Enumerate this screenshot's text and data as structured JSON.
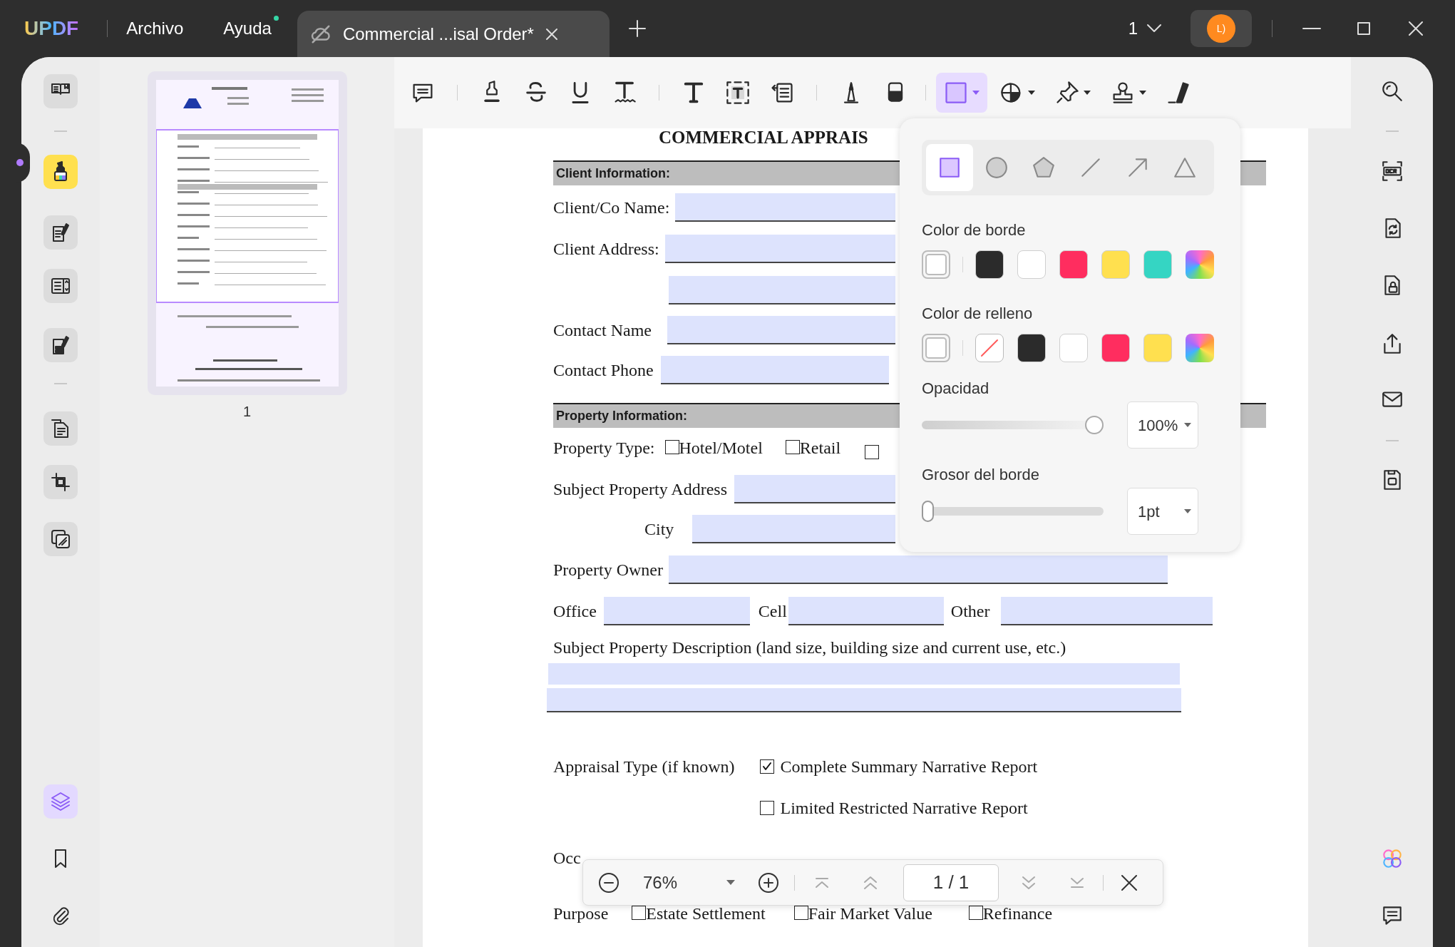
{
  "titlebar": {
    "logo": "UPDF",
    "menu": [
      {
        "label": "Archivo",
        "notification": false
      },
      {
        "label": "Ayuda",
        "notification": true
      }
    ],
    "tab": {
      "title": "Commercial ...isal Order*"
    },
    "page_indicator": "1",
    "avatar": "L)"
  },
  "left_rail": [
    {
      "kind": "reader",
      "selected": false
    },
    {
      "kind": "comment",
      "selected": true
    },
    {
      "kind": "edit",
      "selected": false
    },
    {
      "kind": "form",
      "selected": false
    },
    {
      "kind": "sign",
      "selected": false
    },
    {
      "kind": "organize",
      "selected": false
    },
    {
      "kind": "crop",
      "selected": false
    },
    {
      "kind": "tools",
      "selected": false
    }
  ],
  "left_rail_bottom": [
    {
      "kind": "layers",
      "selected": true
    },
    {
      "kind": "bookmark",
      "selected": false
    },
    {
      "kind": "attachment",
      "selected": false
    }
  ],
  "thumbnails": [
    {
      "page": "1",
      "selected": true
    }
  ],
  "toolbar": [
    {
      "kind": "comment",
      "selected": false,
      "menu": false
    },
    {
      "kind": "highlight",
      "selected": false,
      "menu": false
    },
    {
      "kind": "strikethrough",
      "selected": false,
      "menu": false
    },
    {
      "kind": "underline",
      "selected": false,
      "menu": false
    },
    {
      "kind": "squiggly",
      "selected": false,
      "menu": false
    },
    {
      "kind": "text",
      "selected": false,
      "menu": false
    },
    {
      "kind": "textbox",
      "selected": false,
      "menu": false
    },
    {
      "kind": "callout",
      "selected": false,
      "menu": false
    },
    {
      "kind": "pencil",
      "selected": false,
      "menu": false
    },
    {
      "kind": "eraser",
      "selected": false,
      "menu": false
    },
    {
      "kind": "rectangle",
      "selected": true,
      "menu": true
    },
    {
      "kind": "shape",
      "selected": false,
      "menu": true
    },
    {
      "kind": "pin",
      "selected": false,
      "menu": true
    },
    {
      "kind": "stamp",
      "selected": false,
      "menu": true
    },
    {
      "kind": "signature",
      "selected": false,
      "menu": false
    }
  ],
  "right_rail": [
    {
      "kind": "search"
    },
    {
      "kind": "ocr"
    },
    {
      "kind": "convert"
    },
    {
      "kind": "protect"
    },
    {
      "kind": "share"
    },
    {
      "kind": "email"
    },
    {
      "kind": "save"
    },
    {
      "kind": "ai"
    },
    {
      "kind": "comments"
    }
  ],
  "document": {
    "title": "COMMERCIAL APPRAIS",
    "rows": [
      {
        "kind": "section",
        "label": "Client Information:"
      },
      {
        "kind": "field",
        "label": "Client/Co Name:"
      },
      {
        "kind": "field",
        "label": "Client Address:"
      },
      {
        "kind": "field"
      },
      {
        "kind": "field",
        "label": "Contact Name"
      },
      {
        "kind": "field",
        "label": "Contact Phone"
      },
      {
        "kind": "section",
        "label": "Property Information:"
      },
      {
        "kind": "options",
        "label": "Property Type:",
        "options": [
          {
            "label": "Hotel/Motel",
            "checked": false
          },
          {
            "label": "Retail",
            "checked": false
          },
          {
            "checked": false
          }
        ]
      },
      {
        "kind": "field",
        "label": "Subject Property Address"
      },
      {
        "kind": "field",
        "label": "City"
      },
      {
        "kind": "field",
        "label": "Property Owner"
      },
      {
        "kind": "fields",
        "fields": [
          {
            "label": "Office"
          },
          {
            "label": "Cell"
          },
          {
            "label": "Other"
          }
        ]
      },
      {
        "kind": "text",
        "label": "Subject Property Description (land size, building size and current use, etc.)"
      },
      {
        "kind": "area"
      },
      {
        "kind": "option_list",
        "label": "Appraisal Type (if known)",
        "options": [
          {
            "label": "Complete Summary Narrative Report",
            "checked": true
          },
          {
            "label": "Limited Restricted Narrative Report",
            "checked": false
          }
        ]
      },
      {
        "kind": "text",
        "label": "Occ"
      },
      {
        "kind": "options",
        "label": "Purpose",
        "options": [
          {
            "label": "Estate Settlement",
            "checked": false
          },
          {
            "label": "Fair Market Value",
            "checked": false
          },
          {
            "label": "Refinance",
            "checked": false
          }
        ]
      }
    ]
  },
  "shape_panel": {
    "shapes": [
      {
        "kind": "rectangle",
        "selected": true
      },
      {
        "kind": "ellipse",
        "selected": false
      },
      {
        "kind": "polygon",
        "selected": false
      },
      {
        "kind": "line",
        "selected": false
      },
      {
        "kind": "arrow",
        "selected": false
      },
      {
        "kind": "triangle",
        "selected": false
      }
    ],
    "border_color": {
      "label": "Color de borde",
      "swatches": [
        {
          "kind": "current",
          "color": "#ffffff"
        },
        {
          "kind": "color",
          "color": "#2b2b2b"
        },
        {
          "kind": "color",
          "color": "#ffffff"
        },
        {
          "kind": "color",
          "color": "#ff2d5f"
        },
        {
          "kind": "color",
          "color": "#ffe04f"
        },
        {
          "kind": "color",
          "color": "#35d5c3"
        },
        {
          "kind": "gradient"
        }
      ]
    },
    "fill_color": {
      "label": "Color de relleno",
      "swatches": [
        {
          "kind": "current",
          "color": "#ffffff"
        },
        {
          "kind": "none"
        },
        {
          "kind": "color",
          "color": "#2b2b2b"
        },
        {
          "kind": "color",
          "color": "#ffffff"
        },
        {
          "kind": "color",
          "color": "#ff2d5f"
        },
        {
          "kind": "color",
          "color": "#ffe04f"
        },
        {
          "kind": "gradient"
        }
      ]
    },
    "opacity": {
      "label": "Opacidad",
      "level": 1,
      "value": "100%"
    },
    "border_width": {
      "label": "Grosor del borde",
      "level": 0,
      "value": "1pt"
    }
  },
  "zoom_bar": {
    "zoom": "76%",
    "page": "1 / 1"
  }
}
